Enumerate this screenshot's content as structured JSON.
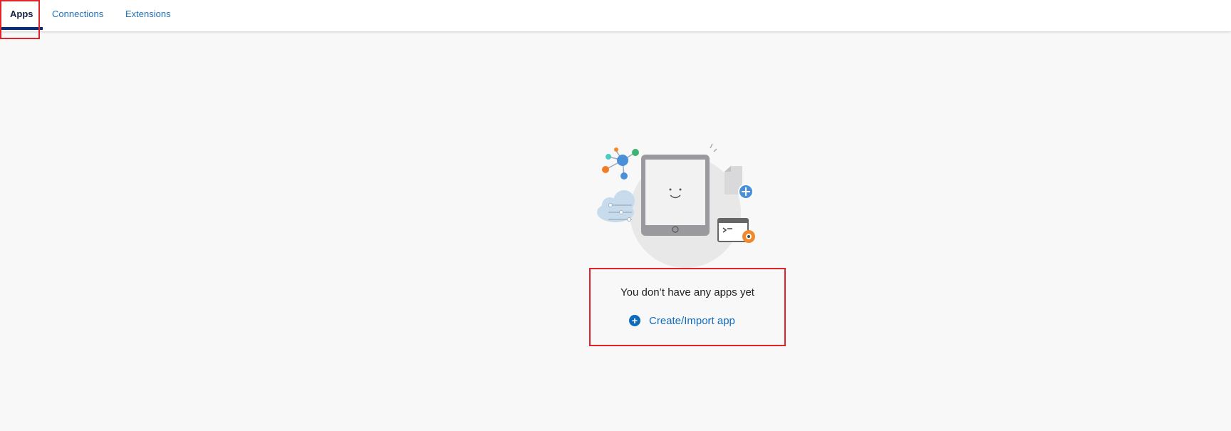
{
  "tabs": [
    {
      "label": "Apps",
      "active": true
    },
    {
      "label": "Connections",
      "active": false
    },
    {
      "label": "Extensions",
      "active": false
    }
  ],
  "empty_state": {
    "message": "You don’t have any apps yet",
    "action_label": "Create/Import app"
  },
  "colors": {
    "active_tab_text": "#16213f",
    "tab_link": "#1d6fb8",
    "underline": "#0b2e73",
    "highlight": "#e0242c",
    "action": "#0f6cbd",
    "background": "#f8f8f8"
  },
  "icons": {
    "action": "plus-circle-icon",
    "illustration": "empty-apps-illustration"
  }
}
